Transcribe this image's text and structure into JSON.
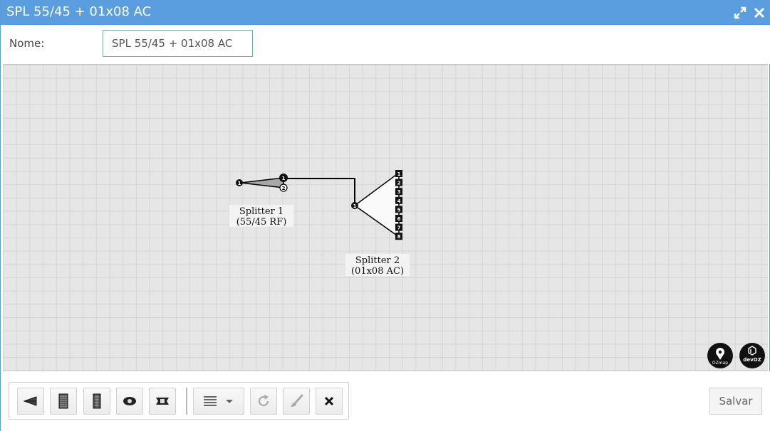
{
  "window": {
    "title": "SPL 55/45 + 01x08 AC",
    "maximize_icon": "expand-arrows-icon",
    "close_icon": "close-x-icon",
    "title_bar_color": "#5b9ee0"
  },
  "form": {
    "name_label": "Nome:",
    "name_value": "SPL 55/45 + 01x08 AC"
  },
  "diagram": {
    "splitter1": {
      "name": "Splitter 1",
      "detail": "(55/45 RF)",
      "input_port": "1",
      "output_ports": [
        "1",
        "2"
      ]
    },
    "splitter2": {
      "name": "Splitter 2",
      "detail": "(01x08 AC)",
      "input_port": "1",
      "output_ports": [
        "1",
        "2",
        "3",
        "4",
        "5",
        "6",
        "7",
        "8"
      ]
    },
    "logos": [
      {
        "icon": "ozmap-logo-icon",
        "text": "OZmap"
      },
      {
        "icon": "devoz-logo-icon",
        "text": "devOZ"
      }
    ]
  },
  "toolbar": {
    "buttons": [
      {
        "icon": "splitter-unbalanced-icon"
      },
      {
        "icon": "connector-block-icon"
      },
      {
        "icon": "connector-strip-icon"
      },
      {
        "icon": "fusion-eye-icon"
      },
      {
        "icon": "adapter-icon"
      },
      {
        "icon": "list-menu-icon"
      },
      {
        "icon": "redo-icon"
      },
      {
        "icon": "paint-brush-icon"
      },
      {
        "icon": "close-x-icon"
      }
    ],
    "save_label": "Salvar"
  }
}
